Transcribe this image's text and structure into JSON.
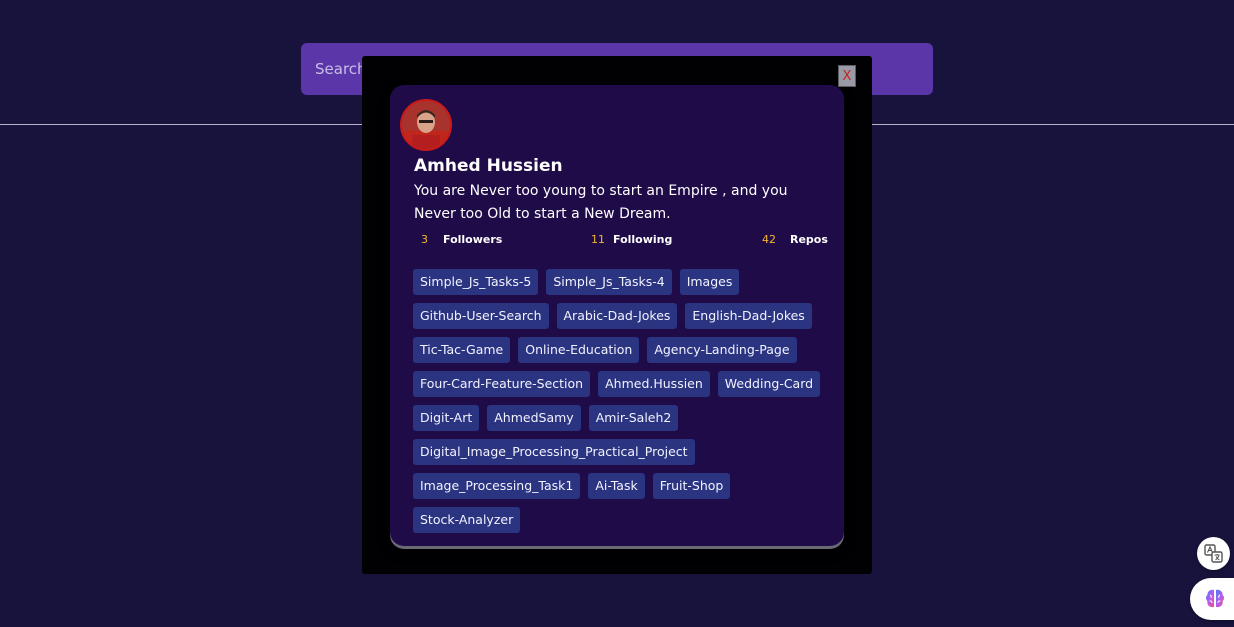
{
  "search": {
    "placeholder": "Search"
  },
  "modal": {
    "close_label": "X"
  },
  "profile": {
    "name": "Amhed Hussien",
    "bio": "You are Never too young to start an Empire , and you Never too Old to start a New Dream.",
    "stats": {
      "followers": {
        "count": "3",
        "label": "Followers"
      },
      "following": {
        "count": "11",
        "label": "Following"
      },
      "repos": {
        "count": "42",
        "label": "Repos"
      }
    },
    "repositories": [
      "Simple_Js_Tasks-5",
      "Simple_Js_Tasks-4",
      "Images",
      "Github-User-Search",
      "Arabic-Dad-Jokes",
      "English-Dad-Jokes",
      "Tic-Tac-Game",
      "Online-Education",
      "Agency-Landing-Page",
      "Four-Card-Feature-Section",
      "Ahmed.Hussien",
      "Wedding-Card",
      "Digit-Art",
      "AhmedSamy",
      "Amir-Saleh2",
      "Digital_Image_Processing_Practical_Project",
      "Image_Processing_Task1",
      "Ai-Task",
      "Fruit-Shop",
      "Stock-Analyzer"
    ]
  },
  "icons": {
    "avatar": "user-photo",
    "translate": "translate-icon",
    "brain": "brain-icon"
  },
  "colors": {
    "background": "#17133c",
    "search_bar": "#5a36a8",
    "card": "#1e0b48",
    "repo_tag": "#2b3481",
    "stat_count": "#f5b731",
    "avatar_border": "#c81a1a"
  }
}
